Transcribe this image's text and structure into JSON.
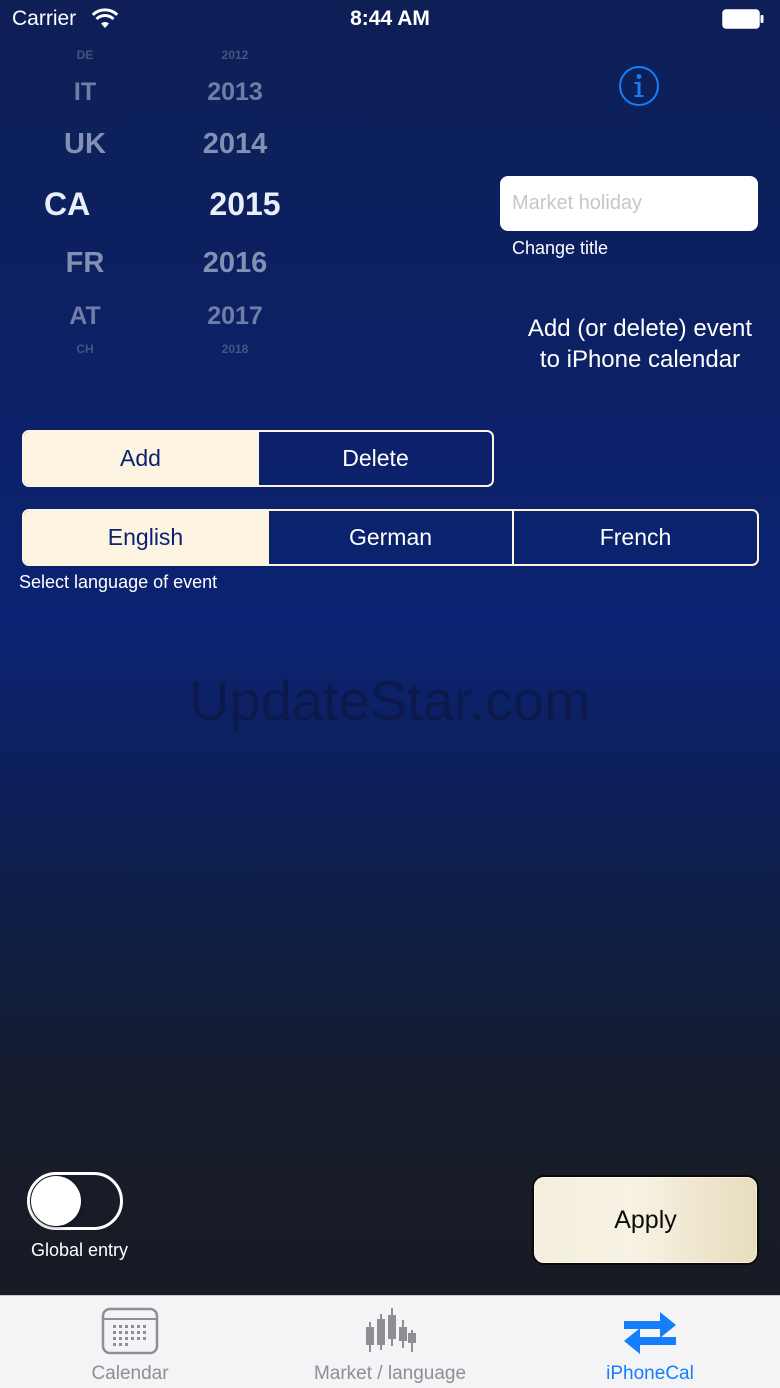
{
  "status_bar": {
    "carrier": "Carrier",
    "time": "8:44 AM"
  },
  "country_picker": {
    "rows": [
      "DE",
      "IT",
      "UK",
      "CA",
      "FR",
      "AT",
      "CH"
    ],
    "selected": "CA"
  },
  "year_picker": {
    "rows": [
      "2012",
      "2013",
      "2014",
      "2015",
      "2016",
      "2017",
      "2018"
    ],
    "selected": "2015"
  },
  "title_field": {
    "value": "",
    "placeholder": "Market holiday",
    "label": "Change title"
  },
  "description": "Add (or delete) event to iPhone calendar",
  "action_segment": {
    "options": [
      "Add",
      "Delete"
    ],
    "selected": "Add"
  },
  "language_segment": {
    "options": [
      "English",
      "German",
      "French"
    ],
    "selected": "English",
    "label": "Select language of event"
  },
  "watermark": "UpdateStar.com",
  "global_entry": {
    "label": "Global entry",
    "on": false
  },
  "apply_button": {
    "label": "Apply"
  },
  "tabs": [
    {
      "label": "Calendar",
      "icon": "calendar-icon",
      "active": false
    },
    {
      "label": "Market / language",
      "icon": "candlestick-chart-icon",
      "active": false
    },
    {
      "label": "iPhoneCal",
      "icon": "swap-arrows-icon",
      "active": true
    }
  ],
  "colors": {
    "accent": "#157efb",
    "cream": "#fdf5e2",
    "background": "#0b2272"
  }
}
